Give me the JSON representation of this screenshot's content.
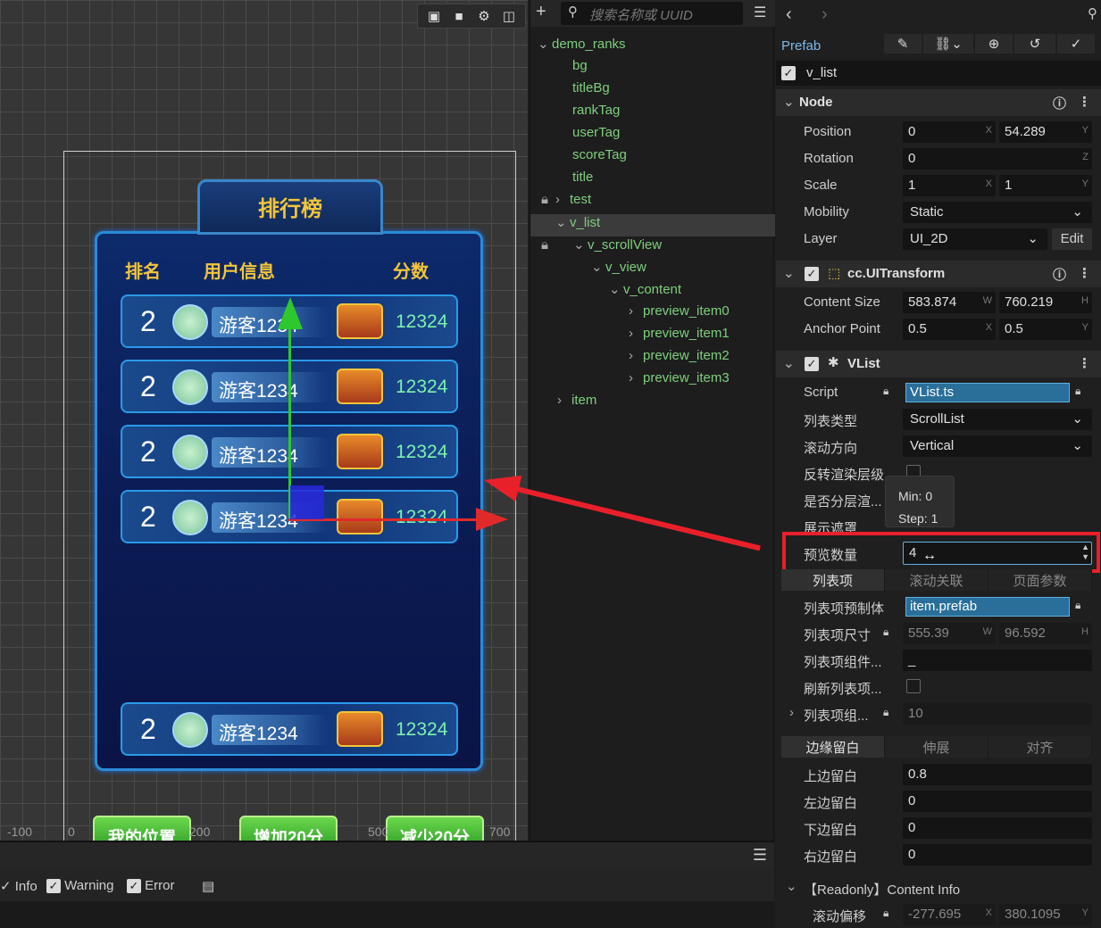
{
  "scene": {
    "tools": [
      "grid-icon",
      "camera-icon",
      "gear-icon",
      "snap-icon"
    ],
    "title": "排行榜",
    "headers": {
      "rank": "排名",
      "user": "用户信息",
      "score": "分数"
    },
    "rows": [
      {
        "rank": "2",
        "name": "游客1234",
        "score": "12324"
      },
      {
        "rank": "2",
        "name": "游客1234",
        "score": "12324"
      },
      {
        "rank": "2",
        "name": "游客1234",
        "score": "12324"
      },
      {
        "rank": "2",
        "name": "游客1234",
        "score": "12324"
      },
      {
        "rank": "2",
        "name": "游客1234",
        "score": "12324"
      }
    ],
    "buttons": {
      "my_pos": "我的位置",
      "add": "增加20分",
      "sub": "减少20分"
    },
    "ruler": [
      "-100",
      "0",
      "200",
      "500",
      "700"
    ]
  },
  "hierarchy": {
    "search_placeholder": "搜索名称或 UUID",
    "root": "demo_ranks",
    "items": [
      "bg",
      "titleBg",
      "rankTag",
      "userTag",
      "scoreTag",
      "title",
      "test",
      "v_list",
      "v_scrollView",
      "v_view",
      "v_content",
      "preview_item0",
      "preview_item1",
      "preview_item2",
      "preview_item3",
      "item"
    ]
  },
  "inspector": {
    "prefab_label": "Prefab",
    "node_name": "v_list",
    "node": {
      "title": "Node",
      "position": {
        "label": "Position",
        "x": "0",
        "y": "54.289"
      },
      "rotation": {
        "label": "Rotation",
        "z": "0"
      },
      "scale": {
        "label": "Scale",
        "x": "1",
        "y": "1"
      },
      "mobility": {
        "label": "Mobility",
        "value": "Static"
      },
      "layer": {
        "label": "Layer",
        "value": "UI_2D",
        "edit": "Edit"
      }
    },
    "uitransform": {
      "title": "cc.UITransform",
      "content_size": {
        "label": "Content Size",
        "w": "583.874",
        "h": "760.219"
      },
      "anchor": {
        "label": "Anchor Point",
        "x": "0.5",
        "y": "0.5"
      }
    },
    "vlist": {
      "title": "VList",
      "script": {
        "label": "Script",
        "value": "VList.ts"
      },
      "list_type": {
        "label": "列表类型",
        "value": "ScrollList"
      },
      "scroll_dir": {
        "label": "滚动方向",
        "value": "Vertical"
      },
      "reverse": {
        "label": "反转渲染层级"
      },
      "layered": {
        "label": "是否分层渲..."
      },
      "show_mask": {
        "label": "展示遮罩"
      },
      "preview_count": {
        "label": "预览数量",
        "value": "4"
      },
      "tabs1": [
        "列表项",
        "滚动关联",
        "页面参数"
      ],
      "item_prefab": {
        "label": "列表项预制体",
        "value": "item.prefab"
      },
      "item_size": {
        "label": "列表项尺寸",
        "w": "555.39",
        "h": "96.592"
      },
      "item_comp": {
        "label": "列表项组件...",
        "value": "_"
      },
      "refresh": {
        "label": "刷新列表项..."
      },
      "item_group": {
        "label": "列表项组...",
        "value": "10"
      },
      "tabs2": [
        "边缘留白",
        "伸展",
        "对齐"
      ],
      "pad_top": {
        "label": "上边留白",
        "value": "0.8"
      },
      "pad_left": {
        "label": "左边留白",
        "value": "0"
      },
      "pad_bottom": {
        "label": "下边留白",
        "value": "0"
      },
      "pad_right": {
        "label": "右边留白",
        "value": "0"
      },
      "readonly": {
        "label": "【Readonly】Content Info"
      },
      "scroll_offset": {
        "label": "滚动偏移",
        "x": "-277.695",
        "y": "380.1095"
      }
    },
    "tooltip": {
      "min": "Min: 0",
      "step": "Step: 1"
    }
  },
  "console": {
    "info": "Info",
    "warning": "Warning",
    "error": "Error"
  },
  "colors": {
    "highlight": "#e8202a",
    "tree_green": "#7fcf7f",
    "accent_blue": "#2a6f9a"
  }
}
